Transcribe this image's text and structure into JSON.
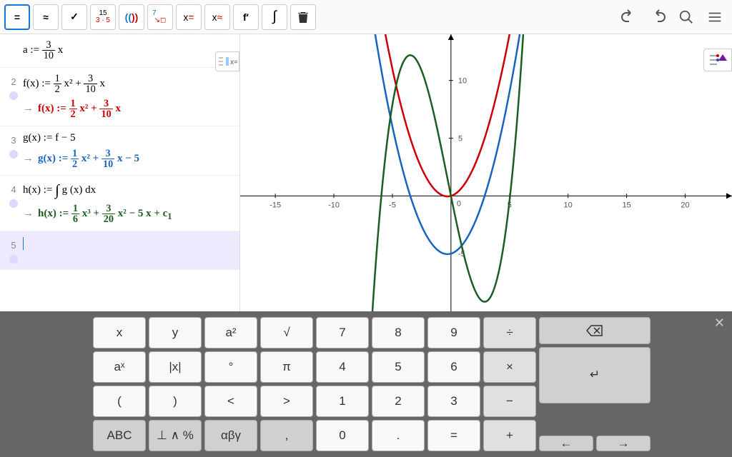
{
  "toolbar": {
    "equals": "=",
    "approx": "≈",
    "check": "✓",
    "factor_top": "15",
    "factor_bot": "3 · 5",
    "parens": "(( ))",
    "sub_top": "7",
    "xeq": "x =",
    "xapprox": "x ≈",
    "deriv": "f′",
    "integral": "∫",
    "trash": "🗑"
  },
  "algebra": {
    "rows": [
      {
        "num": "",
        "line1_html": "a := <frac>3|10</frac> x"
      },
      {
        "num": "2",
        "line1_html": "f(x) := <frac>1|2</frac> x² + <frac>3|10</frac> x",
        "line2_class": "fx-red",
        "line2_html": "f(x) := <frac>1|2</frac> x² + <frac>3|10</frac> x"
      },
      {
        "num": "3",
        "line1_html": "g(x) := f − 5",
        "line2_class": "fx-blue",
        "line2_html": "g(x) := <frac>1|2</frac> x² + <frac>3|10</frac> x − 5"
      },
      {
        "num": "4",
        "line1_html": "h(x) := <int></int> g (x) dx",
        "line2_class": "fx-green",
        "line2_html": "h(x) := <frac>1|6</frac> x³ + <frac>3|20</frac> x² − 5 x + c<sub>1</sub>"
      },
      {
        "num": "5",
        "active": true
      }
    ]
  },
  "chart_data": {
    "type": "line",
    "xlim": [
      -18,
      24
    ],
    "ylim": [
      -10,
      14
    ],
    "xticks": [
      -15,
      -10,
      -5,
      0,
      5,
      10,
      15,
      20
    ],
    "yticks": [
      -5,
      0,
      5,
      10
    ],
    "series": [
      {
        "name": "f",
        "color": "#c00",
        "formula": "0.5*x^2 + 0.3*x"
      },
      {
        "name": "g",
        "color": "#1565C0",
        "formula": "0.5*x^2 + 0.3*x - 5"
      },
      {
        "name": "h",
        "color": "#1B5E20",
        "formula": "(1/6)*x^3 + (3/20)*x^2 - 5*x"
      }
    ]
  },
  "keyboard": {
    "g1": [
      "x",
      "y",
      "a²",
      "√",
      "aˣ",
      "|x|",
      "°",
      "π",
      "(",
      ")",
      "<",
      ">",
      "ABC",
      "⊥ ∧ %",
      "αβγ",
      ","
    ],
    "g2": [
      "7",
      "8",
      "9",
      "÷",
      "4",
      "5",
      "6",
      "×",
      "1",
      "2",
      "3",
      "−",
      "0",
      ".",
      "=",
      "+"
    ],
    "g3": [
      "⌫",
      "↵",
      "←",
      "→"
    ]
  }
}
